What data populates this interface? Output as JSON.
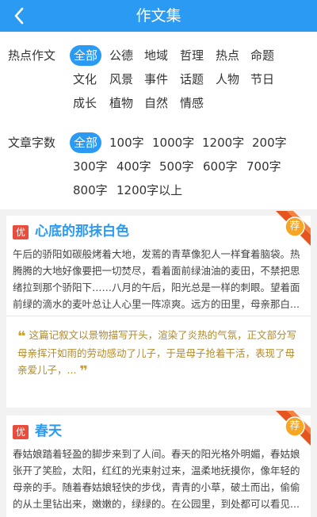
{
  "header": {
    "title": "作文集",
    "back_icon": "chevron-left-icon"
  },
  "filters": {
    "hot": {
      "label": "热点作文",
      "rows": [
        [
          {
            "text": "全部",
            "active": true
          },
          {
            "text": "公德"
          },
          {
            "text": "地域"
          },
          {
            "text": "哲理"
          },
          {
            "text": "热点"
          },
          {
            "text": "命题"
          }
        ],
        [
          {
            "text": "文化"
          },
          {
            "text": "风景"
          },
          {
            "text": "事件"
          },
          {
            "text": "话题"
          },
          {
            "text": "人物"
          },
          {
            "text": "节日"
          }
        ],
        [
          {
            "text": "成长"
          },
          {
            "text": "植物"
          },
          {
            "text": "自然"
          },
          {
            "text": "情感"
          }
        ]
      ]
    },
    "words": {
      "label": "文章字数",
      "rows": [
        [
          {
            "text": "全部",
            "active": true
          },
          {
            "text": "100字"
          },
          {
            "text": "1000字"
          },
          {
            "text": "1200字"
          },
          {
            "text": "200字"
          }
        ],
        [
          {
            "text": "300字"
          },
          {
            "text": "400字"
          },
          {
            "text": "500字"
          },
          {
            "text": "600字"
          },
          {
            "text": "700字"
          }
        ],
        [
          {
            "text": "800字"
          },
          {
            "text": "1200字以上"
          }
        ]
      ]
    }
  },
  "articles": [
    {
      "badge": "优",
      "title": "心底的那抹白色",
      "ribbon": "荐",
      "excerpt": "午后的骄阳如碳般烤着大地，发蔫的青草像犯人一样耷着脑袋。热腾腾的大地好像要把一切焚尽，看着面前绿油油的麦田，不禁把思绪拉到那个骄阳下……八月的午后，阳光总是一样的刺眼。望着面前绿的滴水的麦叶总让人心里一阵凉爽。远方的田里，母亲那白...",
      "comment_open": "❝",
      "comment": "这篇记叙文以景物描写开头，渲染了炎热的气氛，正文部分写母亲挥汗如雨的劳动感动了儿子，于是母子抢着干活，表现了母亲爱儿子，...",
      "comment_close": "❞"
    },
    {
      "badge": "优",
      "title": "春天",
      "ribbon": "荐",
      "excerpt": "春姑娘踏着轻盈的脚步来到了人间。春天的阳光格外明媚，春姑娘张开了笑脸，太阳，红红的光束射过来，温柔地抚摸你，像年轻的母亲的手。随着春姑娘轻快的步伐，青青的小草，破土而出，偷偷的从土里钻出来，嫩嫩的，绿绿的。在公园里，到处都可以看见..."
    }
  ]
}
